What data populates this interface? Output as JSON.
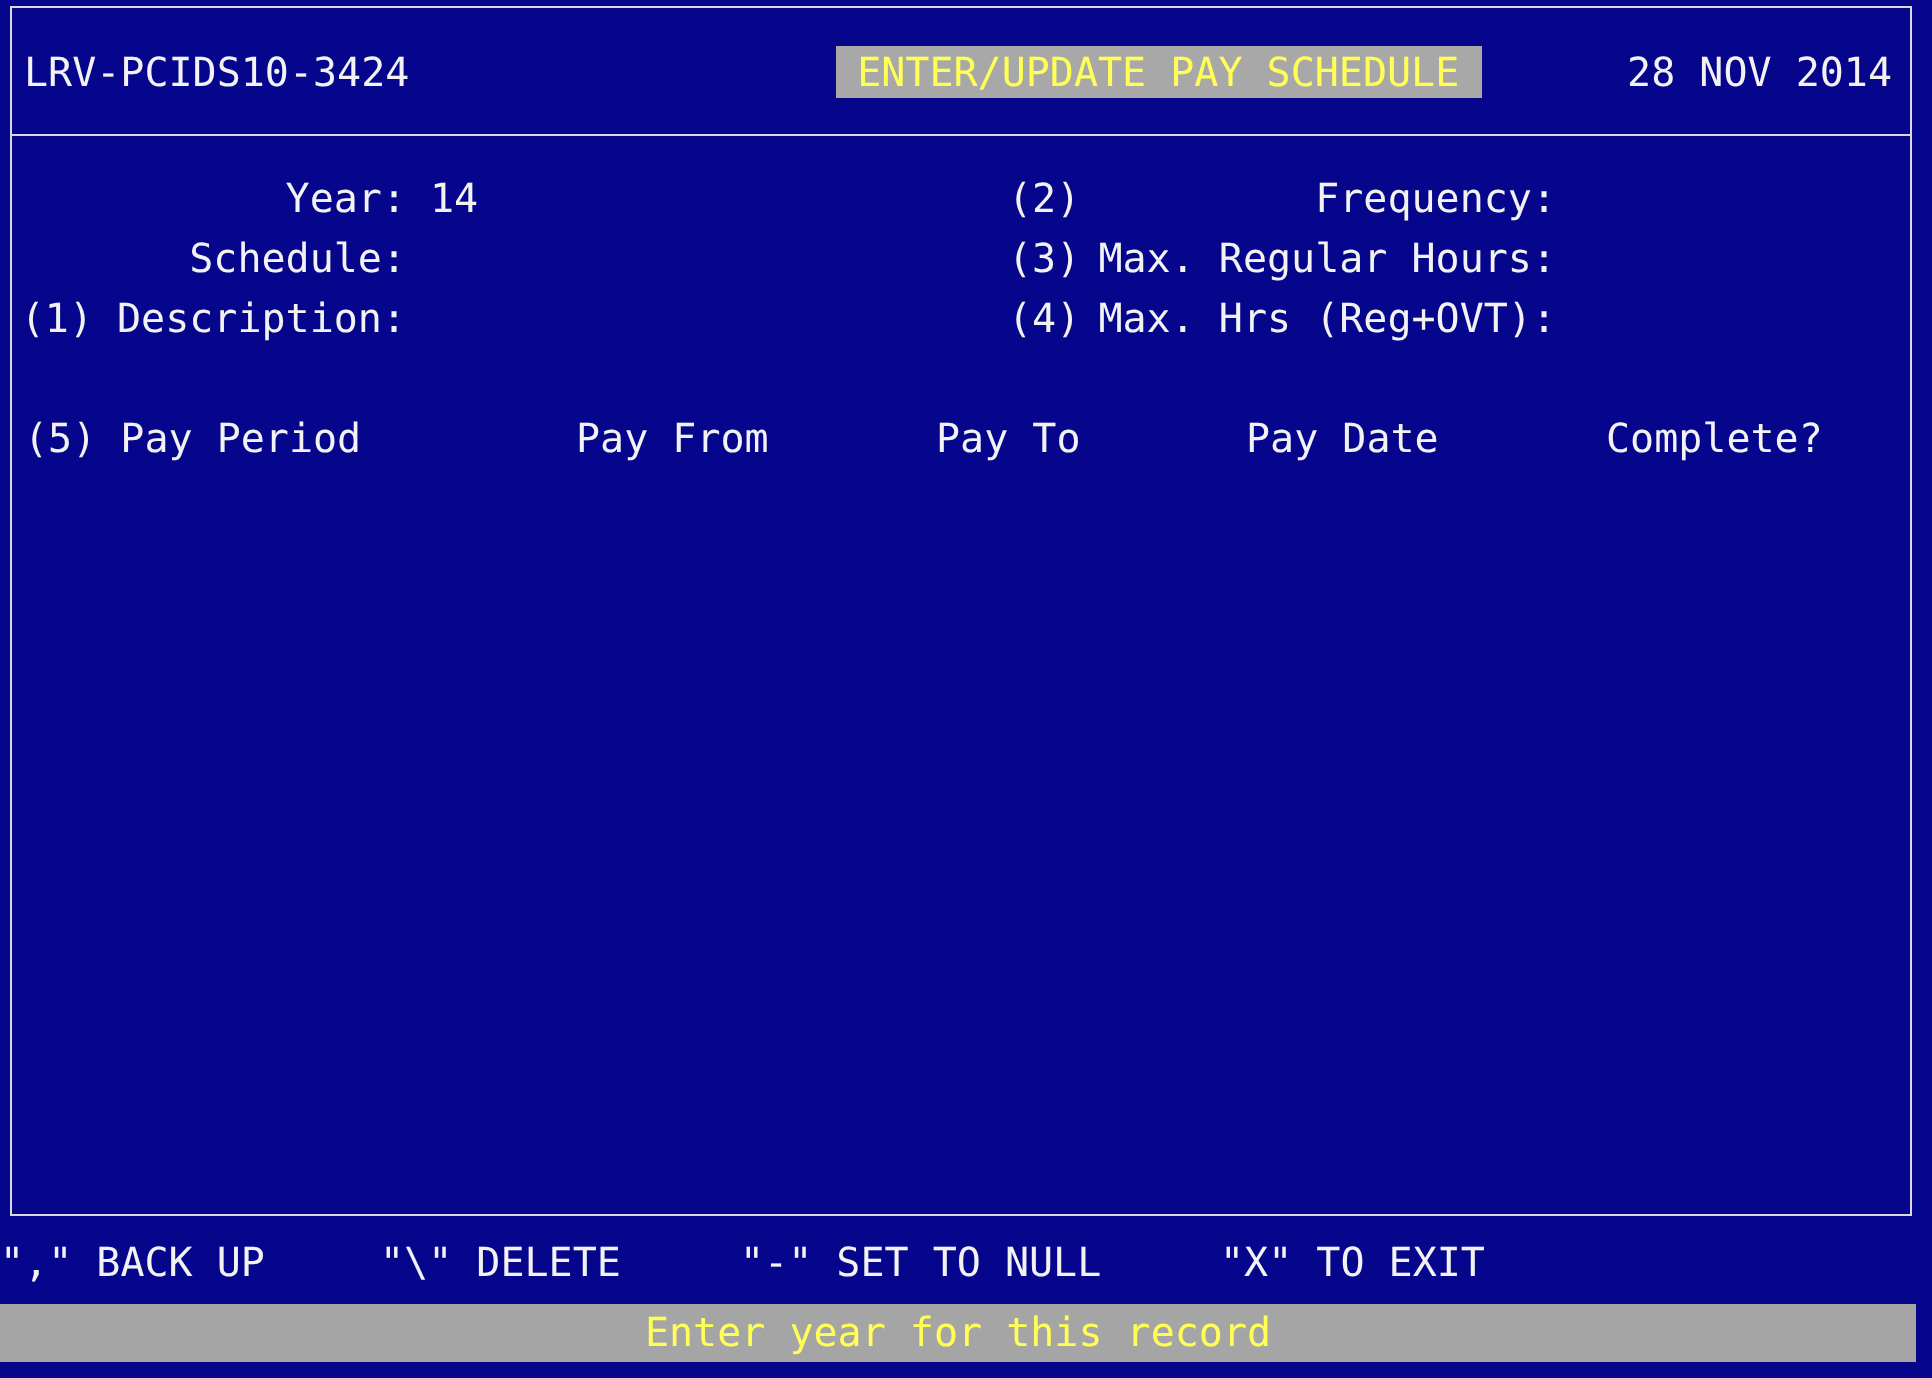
{
  "header": {
    "system_id": "LRV-PCIDS10-3424",
    "title": "ENTER/UPDATE PAY SCHEDULE",
    "date": "28 NOV 2014"
  },
  "left_fields": [
    {
      "label": "Year:",
      "value": "14"
    },
    {
      "label": "Schedule:"
    },
    {
      "number": "(1)",
      "label": "Description:"
    }
  ],
  "right_fields": [
    {
      "number": "(2)",
      "label": "Frequency:"
    },
    {
      "number": "(3)",
      "label": "Max. Regular Hours:"
    },
    {
      "number": "(4)",
      "label": "Max. Hrs (Reg+OVT):"
    }
  ],
  "columns": [
    "(5) Pay Period",
    "Pay From",
    "Pay To",
    "Pay Date",
    "Complete?"
  ],
  "key_hints": [
    "\",\" BACK UP",
    "\"\\\" DELETE",
    "\"-\" SET TO NULL",
    "\"X\" TO EXIT"
  ],
  "status_message": "Enter year for this record"
}
